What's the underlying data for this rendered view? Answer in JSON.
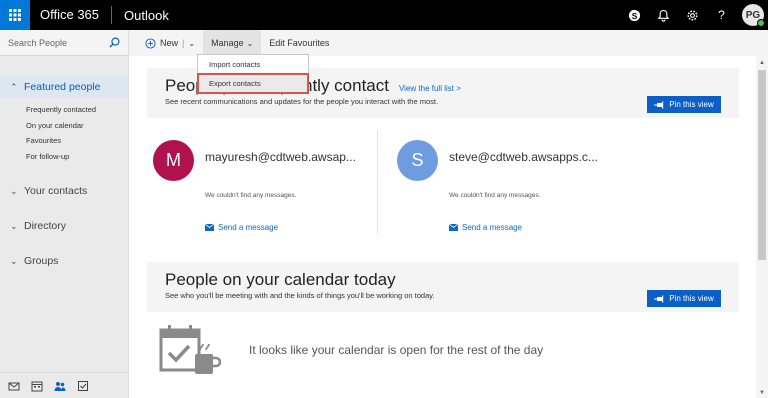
{
  "topbar": {
    "brand": "Office 365",
    "app": "Outlook",
    "icons": [
      "skype-icon",
      "bell-icon",
      "gear-icon",
      "help-icon"
    ],
    "help_label": "?",
    "avatar_initials": "PG"
  },
  "sidebar": {
    "search_placeholder": "Search People",
    "groups": [
      {
        "label": "Featured people",
        "expanded": true,
        "items": [
          "Frequently contacted",
          "On your calendar",
          "Favourites",
          "For follow-up"
        ]
      },
      {
        "label": "Your contacts",
        "expanded": false
      },
      {
        "label": "Directory",
        "expanded": false
      },
      {
        "label": "Groups",
        "expanded": false
      }
    ],
    "bottom_icons": [
      "mail-icon",
      "calendar-icon",
      "people-icon",
      "tasks-icon"
    ]
  },
  "commandbar": {
    "new_label": "New",
    "manage_label": "Manage",
    "edit_label": "Edit Favourites"
  },
  "dropdown": {
    "items": [
      "Import contacts",
      "Export contacts"
    ]
  },
  "section1": {
    "title": "People you frequently contact",
    "link": "View the full list >",
    "subtitle": "See recent communications and updates for the people you interact with the most.",
    "pin_label": "Pin this view",
    "cards": [
      {
        "initial": "M",
        "email": "mayuresh@cdtweb.awsap...",
        "message": "We couldn't find any messages.",
        "send": "Send a message",
        "color": "#b0124f"
      },
      {
        "initial": "S",
        "email": "steve@cdtweb.awsapps.c...",
        "message": "We couldn't find any messages.",
        "send": "Send a message",
        "color": "#6d9de0"
      }
    ]
  },
  "section2": {
    "title": "People on your calendar today",
    "subtitle": "See who you'll be meeting with and the kinds of things you'll be working on today.",
    "pin_label": "Pin this view",
    "empty_text": "It looks like your calendar is open for the rest of the day"
  },
  "colors": {
    "accent": "#0b5fc6",
    "waffle": "#0078d7",
    "highlight_box": "#d9534f"
  }
}
